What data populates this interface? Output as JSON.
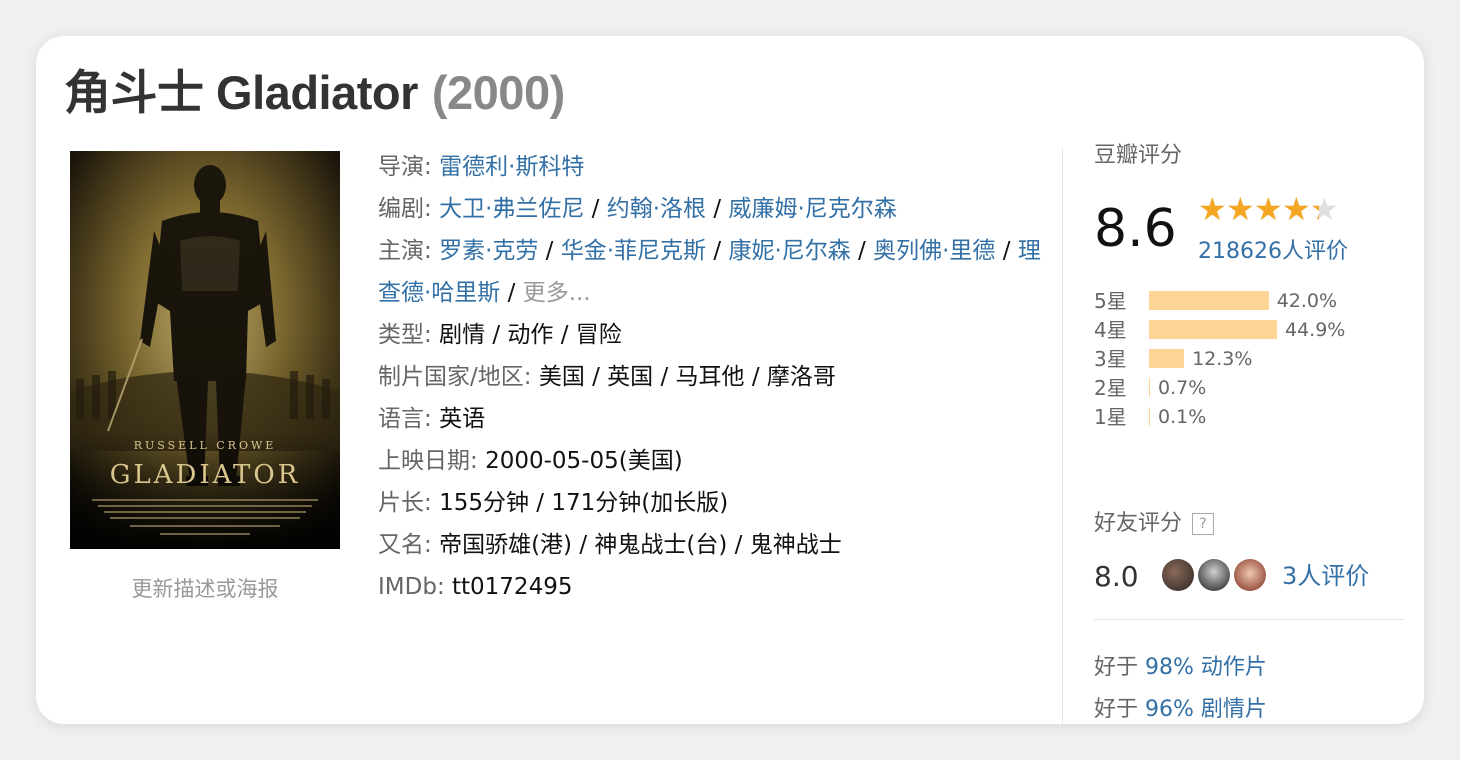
{
  "title": {
    "main": "角斗士 Gladiator",
    "year": "(2000)"
  },
  "poster": {
    "top_credit": "RUSSELL CROWE",
    "name": "GLADIATOR",
    "alt": "Gladiator poster",
    "update_link": "更新描述或海报"
  },
  "info": {
    "director_label": "导演:",
    "director": "雷德利·斯科特",
    "writer_label": "编剧:",
    "writers": [
      "大卫·弗兰佐尼",
      "约翰·洛根",
      "威廉姆·尼克尔森"
    ],
    "cast_label": "主演:",
    "cast": [
      "罗素·克劳",
      "华金·菲尼克斯",
      "康妮·尼尔森",
      "奥列佛·里德",
      "理查德·哈里斯"
    ],
    "cast_more": "更多...",
    "separator": " / ",
    "genre_label": "类型:",
    "genre": "剧情 / 动作 / 冒险",
    "country_label": "制片国家/地区:",
    "country": "美国 / 英国 / 马耳他 / 摩洛哥",
    "language_label": "语言:",
    "language": "英语",
    "release_label": "上映日期:",
    "release": "2000-05-05(美国)",
    "runtime_label": "片长:",
    "runtime": "155分钟 / 171分钟(加长版)",
    "aka_label": "又名:",
    "aka": "帝国骄雄(港) / 神鬼战士(台) / 鬼神战士",
    "imdb_label": "IMDb:",
    "imdb": "tt0172495"
  },
  "rating": {
    "header": "豆瓣评分",
    "score": "8.6",
    "stars_value": 4.3,
    "stars_max": 5,
    "count": "218626人评价",
    "distribution": [
      {
        "label": "5星",
        "percent": 42.0,
        "text": "42.0%"
      },
      {
        "label": "4星",
        "percent": 44.9,
        "text": "44.9%"
      },
      {
        "label": "3星",
        "percent": 12.3,
        "text": "12.3%"
      },
      {
        "label": "2星",
        "percent": 0.7,
        "text": "0.7%"
      },
      {
        "label": "1星",
        "percent": 0.1,
        "text": "0.1%"
      }
    ],
    "bar_color": "#ffd596",
    "star_color": "#f5a623"
  },
  "friends": {
    "header": "好友评分",
    "help": "?",
    "score": "8.0",
    "count": "3人评价",
    "avatar_count": 3
  },
  "better_than": [
    {
      "prefix": "好于 ",
      "link": "98% 动作片"
    },
    {
      "prefix": "好于 ",
      "link": "96% 剧情片"
    }
  ],
  "colors": {
    "link": "#3370a6",
    "label": "#666666",
    "muted": "#999999"
  }
}
